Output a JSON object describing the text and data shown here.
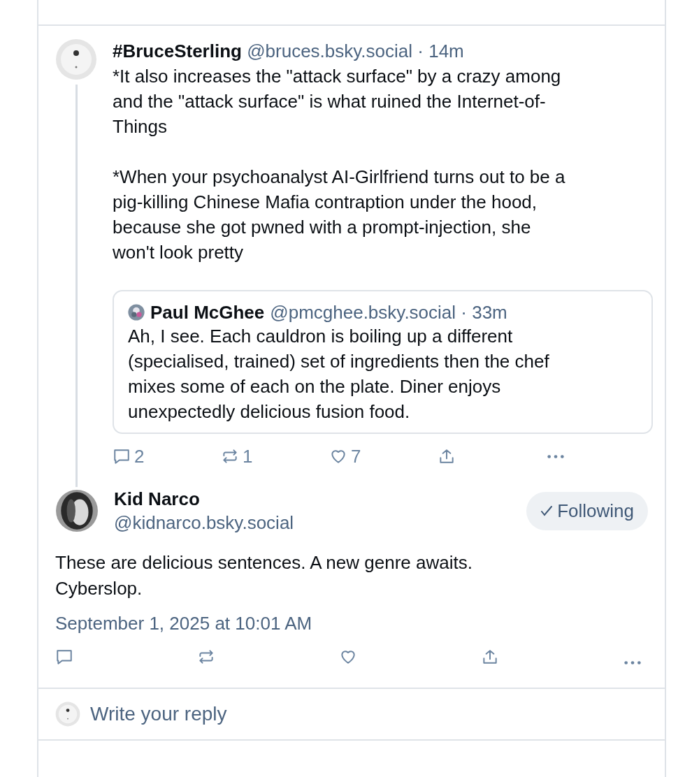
{
  "thread_post": {
    "author": "#BruceSterling",
    "handle": "@bruces.bsky.social",
    "separator": "·",
    "time": "14m",
    "paragraphs": [
      "*It also increases the \"attack surface\" by a crazy among\nand the \"attack surface\" is what ruined the Internet-of-\nThings",
      "*When your psychoanalyst AI-Girlfriend turns out to be a\npig-killing Chinese Mafia contraption under the hood,\nbecause she got pwned with a prompt-injection, she\nwon't look pretty"
    ],
    "quote": {
      "author": "Paul McGhee",
      "handle": "@pmcghee.bsky.social",
      "separator": "·",
      "time": "33m",
      "text": "Ah, I see. Each cauldron is boiling up a different\n(specialised, trained) set of ingredients then the chef\nmixes some of each on the plate. Diner enjoys\nunexpectedly delicious fusion food."
    },
    "actions": [
      {
        "kind": "reply",
        "count": "2"
      },
      {
        "kind": "repost",
        "count": "1"
      },
      {
        "kind": "like",
        "count": "7"
      },
      {
        "kind": "share"
      },
      {
        "kind": "more"
      }
    ]
  },
  "main_post": {
    "author": "Kid Narco",
    "handle": "@kidnarco.bsky.social",
    "follow_button": {
      "label": "Following",
      "following": true
    },
    "text": "These are delicious sentences. A new genre awaits.\nCyberslop.",
    "date": "September 1, 2025 at 10:01 AM",
    "actions": [
      {
        "kind": "reply"
      },
      {
        "kind": "repost"
      },
      {
        "kind": "like"
      },
      {
        "kind": "share"
      },
      {
        "kind": "more"
      }
    ]
  },
  "reply_bar": {
    "placeholder": "Write your reply"
  }
}
